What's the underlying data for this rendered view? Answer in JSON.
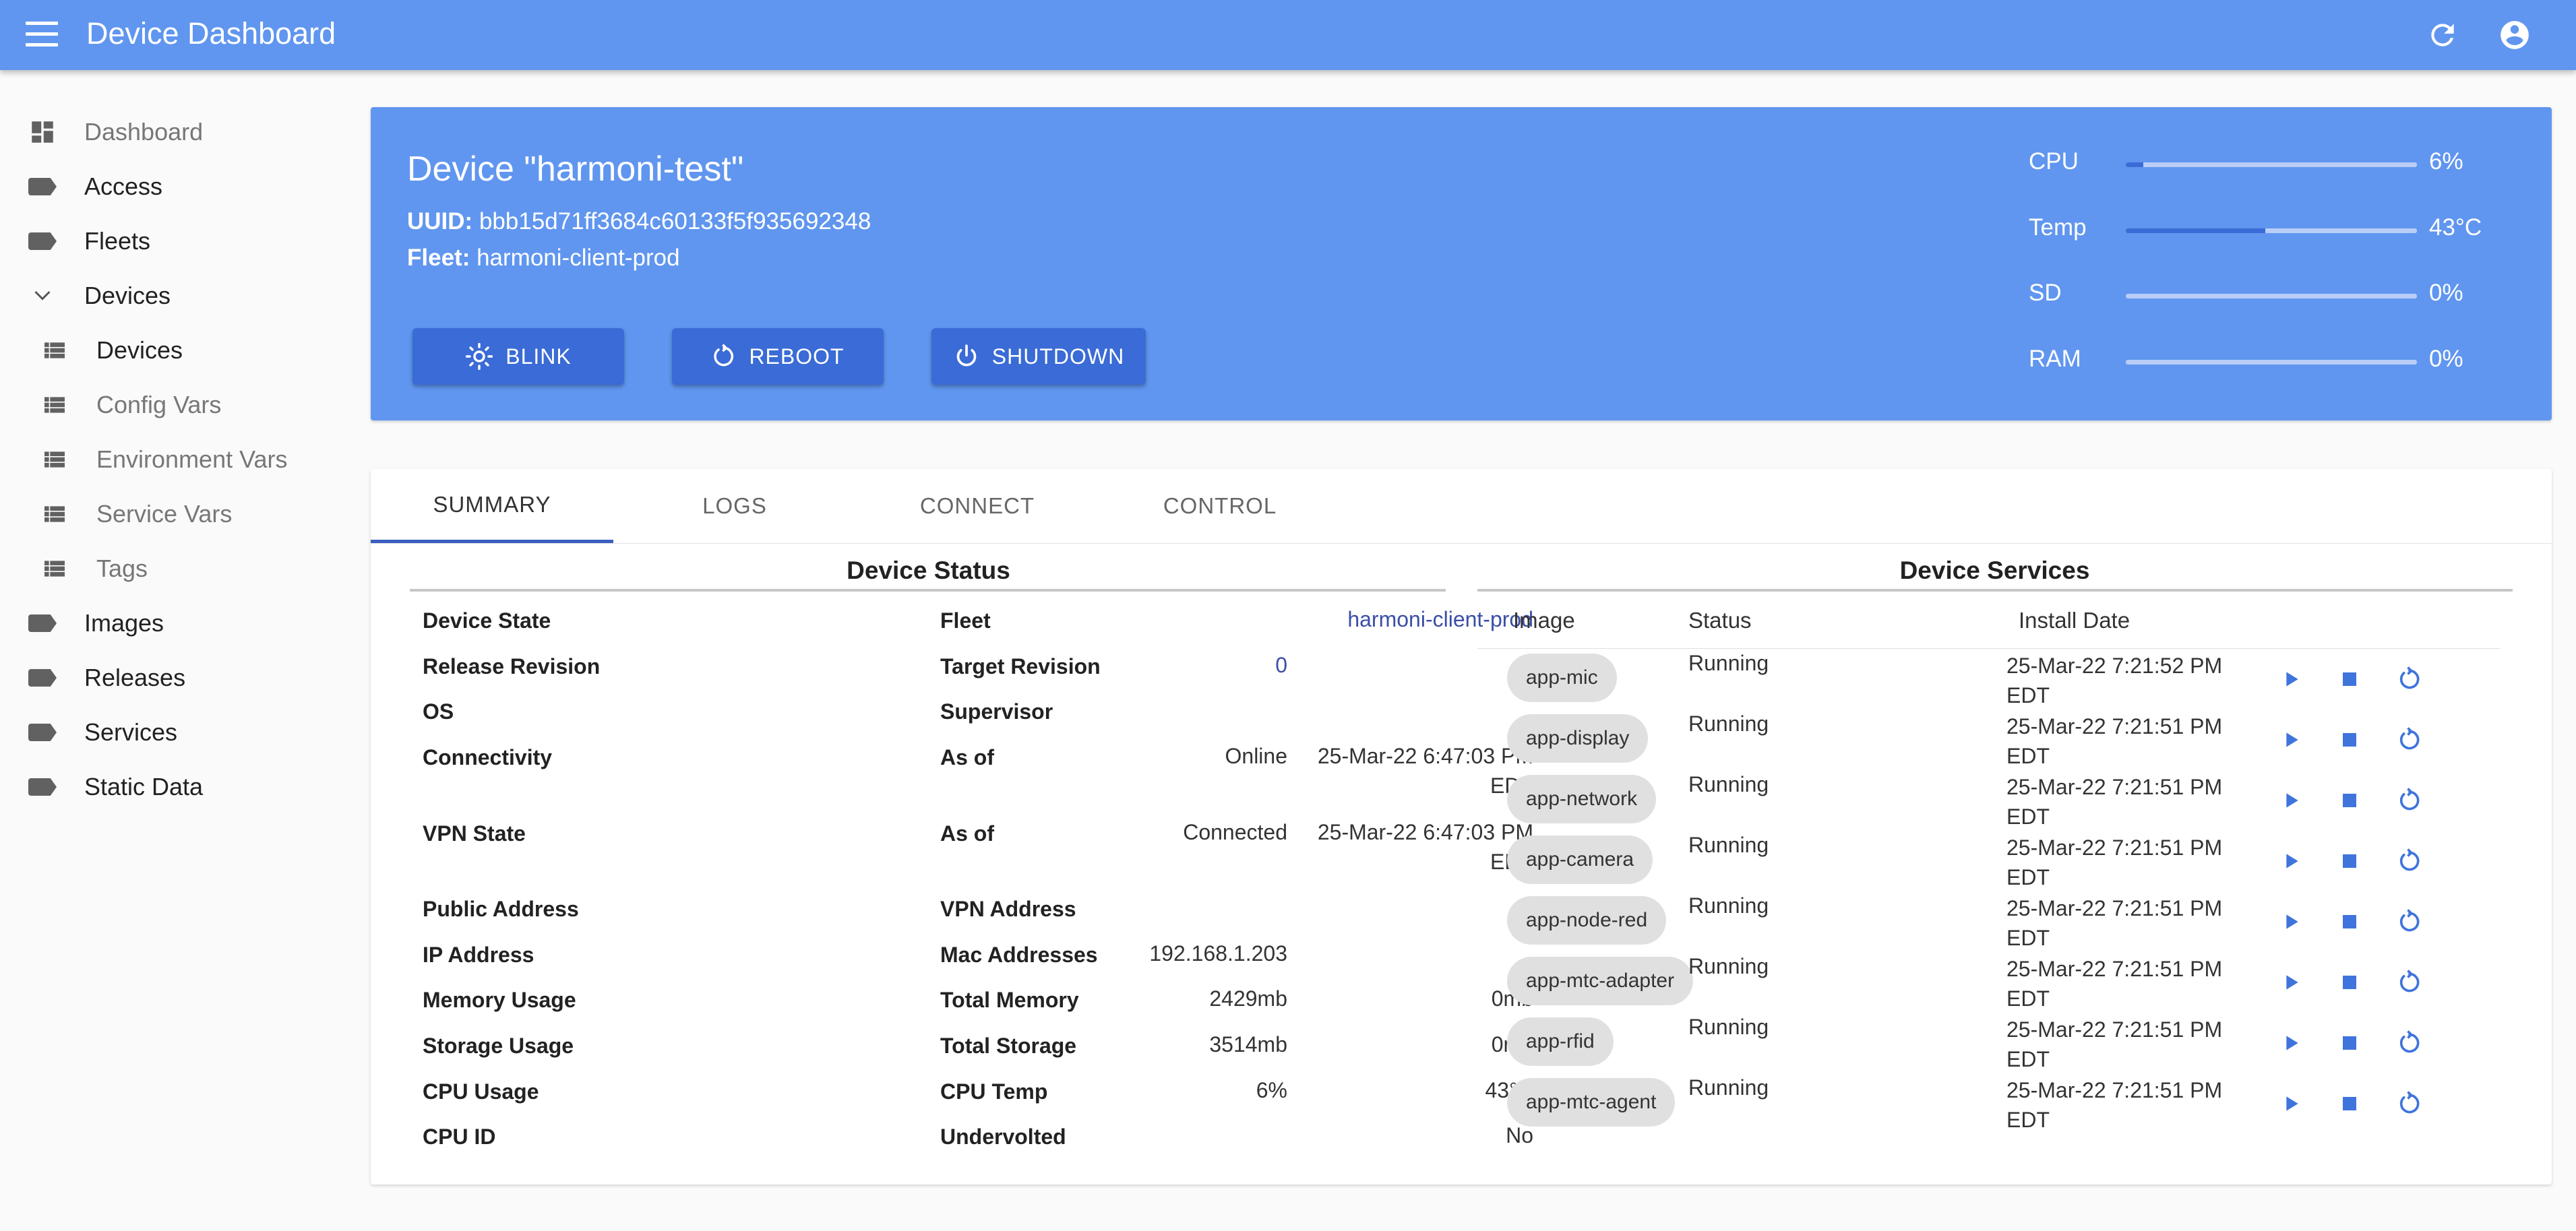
{
  "app": {
    "title": "Device Dashboard"
  },
  "sidebar": {
    "items": [
      {
        "label": "Dashboard",
        "icon": "dashboard-icon",
        "dim": true
      },
      {
        "label": "Access",
        "icon": "label-icon"
      },
      {
        "label": "Fleets",
        "icon": "label-icon"
      },
      {
        "label": "Devices",
        "icon": "chevron-down-icon"
      },
      {
        "label": "Devices",
        "icon": "list-icon",
        "sub": true
      },
      {
        "label": "Config Vars",
        "icon": "list-icon",
        "sub": true,
        "dim": true
      },
      {
        "label": "Environment Vars",
        "icon": "list-icon",
        "sub": true,
        "dim": true
      },
      {
        "label": "Service Vars",
        "icon": "list-icon",
        "sub": true,
        "dim": true
      },
      {
        "label": "Tags",
        "icon": "list-icon",
        "sub": true,
        "dim": true
      },
      {
        "label": "Images",
        "icon": "label-icon"
      },
      {
        "label": "Releases",
        "icon": "label-icon"
      },
      {
        "label": "Services",
        "icon": "label-icon"
      },
      {
        "label": "Static Data",
        "icon": "label-icon"
      }
    ]
  },
  "device": {
    "title": "Device \"harmoni-test\"",
    "uuid_label": "UUID:",
    "uuid": "bbb15d71ff3684c60133f5f935692348",
    "fleet_label": "Fleet:",
    "fleet": "harmoni-client-prod",
    "buttons": {
      "blink": "BLINK",
      "reboot": "REBOOT",
      "shutdown": "SHUTDOWN"
    },
    "stats": [
      {
        "label": "CPU",
        "value": "6%",
        "level": 0.06
      },
      {
        "label": "Temp",
        "value": "43°C",
        "level": 0.48
      },
      {
        "label": "SD",
        "value": "0%",
        "level": 0
      },
      {
        "label": "RAM",
        "value": "0%",
        "level": 0
      }
    ]
  },
  "tabs": [
    "SUMMARY",
    "LOGS",
    "CONNECT",
    "CONTROL"
  ],
  "status": {
    "title": "Device Status",
    "left": [
      {
        "k": "Device State",
        "v": ""
      },
      {
        "k": "Release Revision",
        "v": "0"
      },
      {
        "k": "OS",
        "v": ""
      },
      {
        "k": "Connectivity",
        "v": "Online"
      },
      {
        "k": "VPN State",
        "v": "Connected"
      },
      {
        "k": "Public Address",
        "v": ""
      },
      {
        "k": "IP Address",
        "v": "192.168.1.203"
      },
      {
        "k": "Memory Usage",
        "v": "2429mb"
      },
      {
        "k": "Storage Usage",
        "v": "3514mb"
      },
      {
        "k": "CPU Usage",
        "v": "6%"
      },
      {
        "k": "CPU ID",
        "v": ""
      }
    ],
    "right": [
      {
        "k": "Fleet",
        "v": "harmoni-client-prod"
      },
      {
        "k": "Target Revision",
        "v": ""
      },
      {
        "k": "Supervisor",
        "v": ""
      },
      {
        "k": "As of",
        "v": "25-Mar-22 6:47:03 PM",
        "v2": "EDT"
      },
      {
        "k": "As of",
        "v": "25-Mar-22 6:47:03 PM",
        "v2": "EDT"
      },
      {
        "k": "VPN Address",
        "v": ""
      },
      {
        "k": "Mac Addresses",
        "v": ""
      },
      {
        "k": "Total Memory",
        "v": "0mb"
      },
      {
        "k": "Total Storage",
        "v": "0mb"
      },
      {
        "k": "CPU Temp",
        "v": "43°C"
      },
      {
        "k": "Undervolted",
        "v": "No"
      }
    ]
  },
  "services": {
    "title": "Device Services",
    "headers": {
      "image": "Image",
      "status": "Status",
      "install_date": "Install Date"
    },
    "rows": [
      {
        "image": "app-mic",
        "status": "Running",
        "date": "25-Mar-22 7:21:52 PM",
        "tz": "EDT"
      },
      {
        "image": "app-display",
        "status": "Running",
        "date": "25-Mar-22 7:21:51 PM",
        "tz": "EDT"
      },
      {
        "image": "app-network",
        "status": "Running",
        "date": "25-Mar-22 7:21:51 PM",
        "tz": "EDT"
      },
      {
        "image": "app-camera",
        "status": "Running",
        "date": "25-Mar-22 7:21:51 PM",
        "tz": "EDT"
      },
      {
        "image": "app-node-red",
        "status": "Running",
        "date": "25-Mar-22 7:21:51 PM",
        "tz": "EDT"
      },
      {
        "image": "app-mtc-adapter",
        "status": "Running",
        "date": "25-Mar-22 7:21:51 PM",
        "tz": "EDT"
      },
      {
        "image": "app-rfid",
        "status": "Running",
        "date": "25-Mar-22 7:21:51 PM",
        "tz": "EDT"
      },
      {
        "image": "app-mtc-agent",
        "status": "Running",
        "date": "25-Mar-22 7:21:51 PM",
        "tz": "EDT"
      }
    ]
  },
  "colors": {
    "primary": "#6096ef",
    "button": "#3a6bd6",
    "link": "#3b4ea8",
    "action": "#3f74dc"
  }
}
